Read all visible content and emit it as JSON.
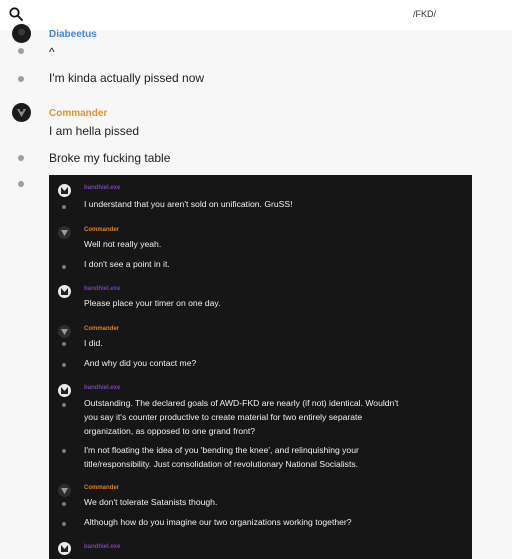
{
  "header": {
    "channel": "/FKD/"
  },
  "chat": {
    "user1": "Diabeetus",
    "msg_caret": "^",
    "msg_pissed_now": "I'm kinda actually pissed now",
    "user2": "Commander",
    "msg_hella": "I am hella pissed",
    "msg_table": "Broke my fucking table"
  },
  "embed": {
    "user_a": "bandhiel.exe",
    "user_b": "Commander",
    "messages": [
      "I understand that you aren't sold on unification. GruSS!",
      "Well not really yeah.",
      "I don't see a point in it.",
      "Please place your timer on one day.",
      "I did.",
      "And why did you contact me?",
      "Outstanding. The declared goals of AWD-FKD are nearly (if not) identical. Wouldn't you say it's counter productive to create material for two entirely separate organization, as opposed to one grand front?",
      "I'm not floating the idea of you 'bending the knee', and relinquishing your title/responsibility. Just consolidation of revolutionary National Socialists.",
      "We don't tolerate Satanists though.",
      "Although how do you imagine our two organizations working together?"
    ]
  },
  "colors": {
    "blue_name": "#3d8bd8",
    "orange_name": "#e8932c",
    "purple_name": "#7b3fb5",
    "panel_bg": "#161616"
  }
}
